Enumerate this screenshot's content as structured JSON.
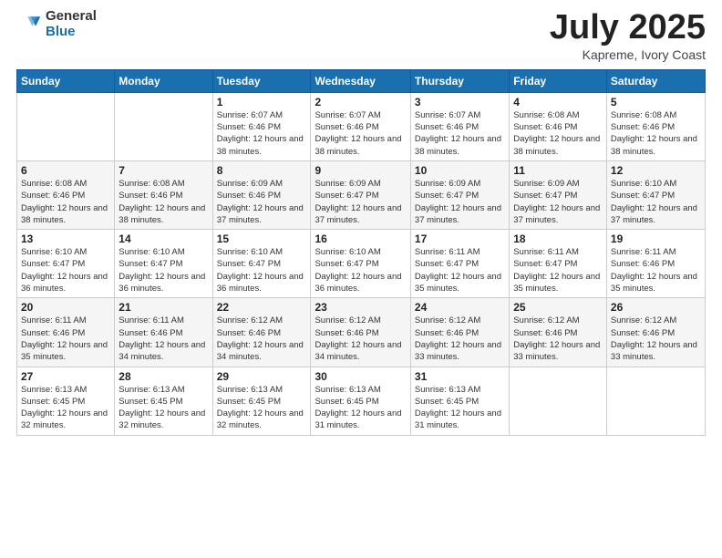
{
  "header": {
    "logo_general": "General",
    "logo_blue": "Blue",
    "month": "July 2025",
    "location": "Kapreme, Ivory Coast"
  },
  "days_of_week": [
    "Sunday",
    "Monday",
    "Tuesday",
    "Wednesday",
    "Thursday",
    "Friday",
    "Saturday"
  ],
  "weeks": [
    [
      {
        "day": "",
        "info": ""
      },
      {
        "day": "",
        "info": ""
      },
      {
        "day": "1",
        "info": "Sunrise: 6:07 AM\nSunset: 6:46 PM\nDaylight: 12 hours and 38 minutes."
      },
      {
        "day": "2",
        "info": "Sunrise: 6:07 AM\nSunset: 6:46 PM\nDaylight: 12 hours and 38 minutes."
      },
      {
        "day": "3",
        "info": "Sunrise: 6:07 AM\nSunset: 6:46 PM\nDaylight: 12 hours and 38 minutes."
      },
      {
        "day": "4",
        "info": "Sunrise: 6:08 AM\nSunset: 6:46 PM\nDaylight: 12 hours and 38 minutes."
      },
      {
        "day": "5",
        "info": "Sunrise: 6:08 AM\nSunset: 6:46 PM\nDaylight: 12 hours and 38 minutes."
      }
    ],
    [
      {
        "day": "6",
        "info": "Sunrise: 6:08 AM\nSunset: 6:46 PM\nDaylight: 12 hours and 38 minutes."
      },
      {
        "day": "7",
        "info": "Sunrise: 6:08 AM\nSunset: 6:46 PM\nDaylight: 12 hours and 38 minutes."
      },
      {
        "day": "8",
        "info": "Sunrise: 6:09 AM\nSunset: 6:46 PM\nDaylight: 12 hours and 37 minutes."
      },
      {
        "day": "9",
        "info": "Sunrise: 6:09 AM\nSunset: 6:47 PM\nDaylight: 12 hours and 37 minutes."
      },
      {
        "day": "10",
        "info": "Sunrise: 6:09 AM\nSunset: 6:47 PM\nDaylight: 12 hours and 37 minutes."
      },
      {
        "day": "11",
        "info": "Sunrise: 6:09 AM\nSunset: 6:47 PM\nDaylight: 12 hours and 37 minutes."
      },
      {
        "day": "12",
        "info": "Sunrise: 6:10 AM\nSunset: 6:47 PM\nDaylight: 12 hours and 37 minutes."
      }
    ],
    [
      {
        "day": "13",
        "info": "Sunrise: 6:10 AM\nSunset: 6:47 PM\nDaylight: 12 hours and 36 minutes."
      },
      {
        "day": "14",
        "info": "Sunrise: 6:10 AM\nSunset: 6:47 PM\nDaylight: 12 hours and 36 minutes."
      },
      {
        "day": "15",
        "info": "Sunrise: 6:10 AM\nSunset: 6:47 PM\nDaylight: 12 hours and 36 minutes."
      },
      {
        "day": "16",
        "info": "Sunrise: 6:10 AM\nSunset: 6:47 PM\nDaylight: 12 hours and 36 minutes."
      },
      {
        "day": "17",
        "info": "Sunrise: 6:11 AM\nSunset: 6:47 PM\nDaylight: 12 hours and 35 minutes."
      },
      {
        "day": "18",
        "info": "Sunrise: 6:11 AM\nSunset: 6:47 PM\nDaylight: 12 hours and 35 minutes."
      },
      {
        "day": "19",
        "info": "Sunrise: 6:11 AM\nSunset: 6:46 PM\nDaylight: 12 hours and 35 minutes."
      }
    ],
    [
      {
        "day": "20",
        "info": "Sunrise: 6:11 AM\nSunset: 6:46 PM\nDaylight: 12 hours and 35 minutes."
      },
      {
        "day": "21",
        "info": "Sunrise: 6:11 AM\nSunset: 6:46 PM\nDaylight: 12 hours and 34 minutes."
      },
      {
        "day": "22",
        "info": "Sunrise: 6:12 AM\nSunset: 6:46 PM\nDaylight: 12 hours and 34 minutes."
      },
      {
        "day": "23",
        "info": "Sunrise: 6:12 AM\nSunset: 6:46 PM\nDaylight: 12 hours and 34 minutes."
      },
      {
        "day": "24",
        "info": "Sunrise: 6:12 AM\nSunset: 6:46 PM\nDaylight: 12 hours and 33 minutes."
      },
      {
        "day": "25",
        "info": "Sunrise: 6:12 AM\nSunset: 6:46 PM\nDaylight: 12 hours and 33 minutes."
      },
      {
        "day": "26",
        "info": "Sunrise: 6:12 AM\nSunset: 6:46 PM\nDaylight: 12 hours and 33 minutes."
      }
    ],
    [
      {
        "day": "27",
        "info": "Sunrise: 6:13 AM\nSunset: 6:45 PM\nDaylight: 12 hours and 32 minutes."
      },
      {
        "day": "28",
        "info": "Sunrise: 6:13 AM\nSunset: 6:45 PM\nDaylight: 12 hours and 32 minutes."
      },
      {
        "day": "29",
        "info": "Sunrise: 6:13 AM\nSunset: 6:45 PM\nDaylight: 12 hours and 32 minutes."
      },
      {
        "day": "30",
        "info": "Sunrise: 6:13 AM\nSunset: 6:45 PM\nDaylight: 12 hours and 31 minutes."
      },
      {
        "day": "31",
        "info": "Sunrise: 6:13 AM\nSunset: 6:45 PM\nDaylight: 12 hours and 31 minutes."
      },
      {
        "day": "",
        "info": ""
      },
      {
        "day": "",
        "info": ""
      }
    ]
  ]
}
